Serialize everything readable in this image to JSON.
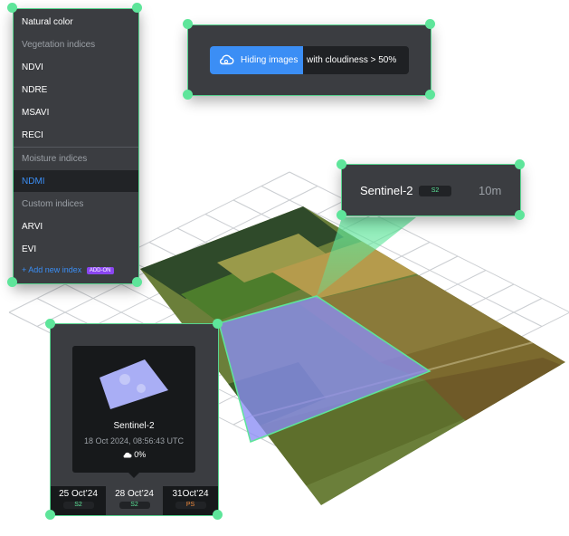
{
  "index_menu": {
    "items": [
      {
        "type": "item",
        "label": "Natural color"
      },
      {
        "type": "header",
        "label": "Vegetation indices"
      },
      {
        "type": "item",
        "label": "NDVI"
      },
      {
        "type": "item",
        "label": "NDRE"
      },
      {
        "type": "item",
        "label": "MSAVI"
      },
      {
        "type": "item",
        "label": "RECI"
      },
      {
        "type": "header",
        "label": "Moisture indices"
      },
      {
        "type": "item",
        "label": "NDMI",
        "selected": true
      },
      {
        "type": "header",
        "label": "Custom indices"
      },
      {
        "type": "item",
        "label": "ARVI"
      },
      {
        "type": "item",
        "label": "EVI"
      }
    ],
    "add_new_label": "+ Add new index",
    "addon_badge": "ADD-ON"
  },
  "cloud_filter": {
    "icon": "cloud-settings-icon",
    "highlight_text": "Hiding images",
    "rest_text": "with cloudiness > 50%"
  },
  "satellite_panel": {
    "name": "Sentinel-2",
    "badge": "S2",
    "resolution": "10m"
  },
  "image_tooltip": {
    "satellite": "Sentinel-2",
    "datetime": "18 Oct 2024, 08:56:43 UTC",
    "cloud_icon": "cloud-icon",
    "cloudiness": "0%"
  },
  "dates": [
    {
      "label": "25 Oct’24",
      "badge": "S2",
      "badge_color": "#5ee59a"
    },
    {
      "label": "28 Oct’24",
      "badge": "S2",
      "badge_color": "#5ee59a",
      "selected": true
    },
    {
      "label": "31Oct’24",
      "badge": "PS",
      "badge_color": "#f08a3c"
    }
  ],
  "colors": {
    "accent_green": "#5ee59a",
    "accent_blue": "#3b8ef5",
    "panel_bg": "#3b3d41",
    "ndmi_overlay": "#8a8df5"
  }
}
